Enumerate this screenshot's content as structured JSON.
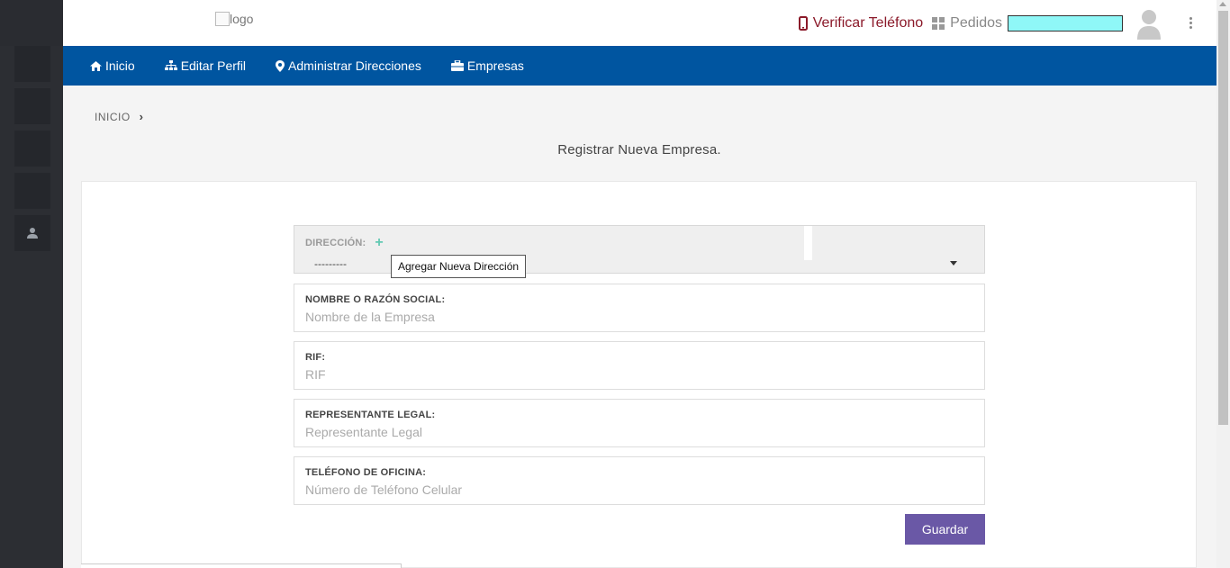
{
  "header": {
    "logo_alt": "logo",
    "verify_phone_label": "Verificar Teléfono",
    "orders_label": "Pedidos"
  },
  "nav": {
    "items": [
      {
        "label": "Inicio",
        "icon": "home-icon"
      },
      {
        "label": "Editar Perfil",
        "icon": "sitemap-icon"
      },
      {
        "label": "Administrar Direcciones",
        "icon": "map-marker-icon"
      },
      {
        "label": "Empresas",
        "icon": "briefcase-icon"
      }
    ]
  },
  "breadcrumb": {
    "home": "INICIO",
    "separator": "›"
  },
  "page": {
    "title": "Registrar Nueva Empresa."
  },
  "form": {
    "direccion": {
      "label": "DIRECCIÓN:",
      "add_symbol": "+",
      "selected": "---------",
      "tooltip": "Agregar Nueva Dirección"
    },
    "nombre": {
      "label": "NOMBRE O RAZÓN SOCIAL:",
      "placeholder": "Nombre de la Empresa"
    },
    "rif": {
      "label": "RIF:",
      "placeholder": "RIF"
    },
    "representante": {
      "label": "REPRESENTANTE LEGAL:",
      "placeholder": "Representante Legal"
    },
    "telefono": {
      "label": "TELÉFONO DE OFICINA:",
      "placeholder": "Número de Teléfono Celular"
    },
    "save_label": "Guardar"
  },
  "colors": {
    "nav_bg": "#0055a0",
    "sidebar_bg": "#2c2e33",
    "save_button": "#6a58a6",
    "verify_phone": "#8b1a2a",
    "add_icon": "#63c9b3",
    "header_box": "#8ff7f7"
  }
}
